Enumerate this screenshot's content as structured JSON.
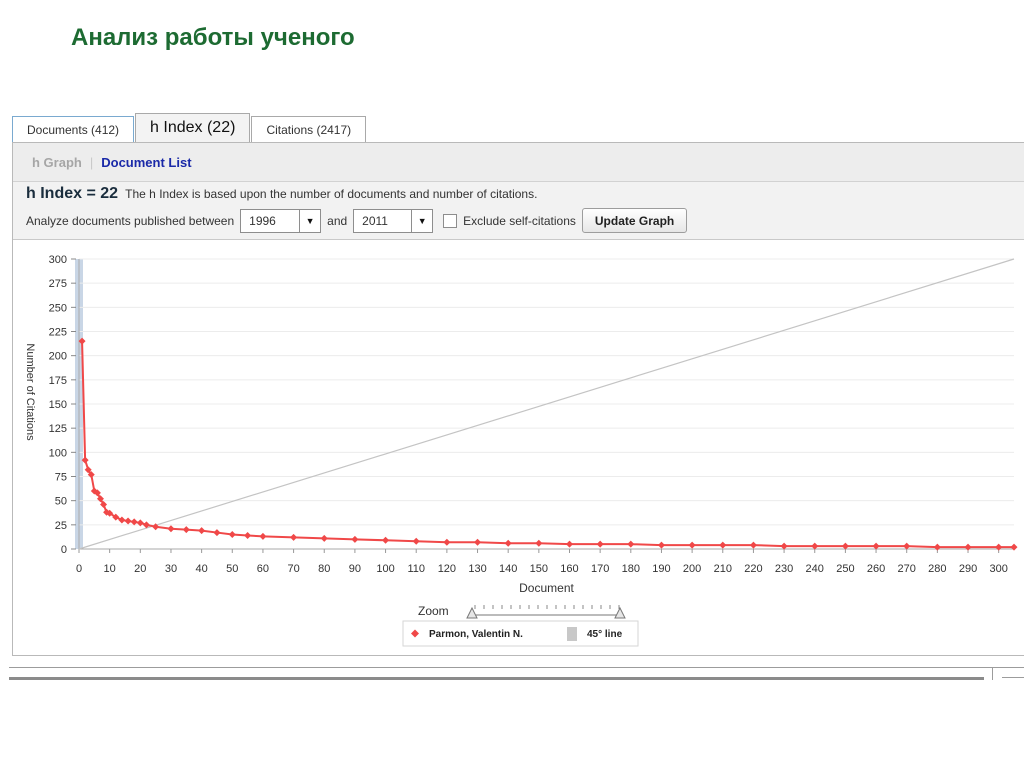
{
  "slide_title": "Анализ работы ученого",
  "tabs": [
    {
      "label": "Documents (412)"
    },
    {
      "label": "h Index (22)"
    },
    {
      "label": "Citations (2417)"
    }
  ],
  "subnav": {
    "h_graph": "h Graph",
    "separator": "|",
    "document_list": "Document List"
  },
  "summary": {
    "h_index_label": "h Index = 22",
    "description": "The h Index is based upon the number of documents and number of citations."
  },
  "filters": {
    "analyze_label": "Analyze documents published between",
    "start_year": "1996",
    "and_label": "and",
    "end_year": "2011",
    "exclude_label": "Exclude self-citations",
    "exclude_checked": false,
    "update_button": "Update Graph"
  },
  "zoom_label": "Zoom",
  "legend": {
    "series": "Parmon, Valentin N.",
    "line": "45° line"
  },
  "colors": {
    "series": "#f04848",
    "diagonal": "#c4c4c4",
    "hbar": "#c9d6e6",
    "title": "#1d6b32"
  },
  "chart_data": {
    "type": "scatter",
    "xlabel": "Document",
    "ylabel": "Number of Citations",
    "xlim": [
      0,
      305
    ],
    "ylim": [
      0,
      300
    ],
    "xticks": [
      0,
      10,
      20,
      30,
      40,
      50,
      60,
      70,
      80,
      90,
      100,
      110,
      120,
      130,
      140,
      150,
      160,
      170,
      180,
      190,
      200,
      210,
      220,
      230,
      240,
      250,
      260,
      270,
      280,
      290,
      300
    ],
    "yticks": [
      0,
      25,
      50,
      75,
      100,
      125,
      150,
      175,
      200,
      225,
      250,
      275,
      300
    ],
    "h_index": 22,
    "diagonal": {
      "name": "45° line",
      "x": [
        0,
        305
      ],
      "y": [
        0,
        300
      ]
    },
    "series": [
      {
        "name": "Parmon, Valentin N.",
        "x": [
          1,
          2,
          3,
          4,
          5,
          6,
          7,
          8,
          9,
          10,
          12,
          14,
          16,
          18,
          20,
          22,
          25,
          30,
          35,
          40,
          45,
          50,
          55,
          60,
          70,
          80,
          90,
          100,
          110,
          120,
          130,
          140,
          150,
          160,
          170,
          180,
          190,
          200,
          210,
          220,
          230,
          240,
          250,
          260,
          270,
          280,
          290,
          300,
          305
        ],
        "y": [
          215,
          92,
          82,
          77,
          60,
          58,
          52,
          46,
          38,
          37,
          33,
          30,
          29,
          28,
          27,
          25,
          23,
          21,
          20,
          19,
          17,
          15,
          14,
          13,
          12,
          11,
          10,
          9,
          8,
          7,
          7,
          6,
          6,
          5,
          5,
          5,
          4,
          4,
          4,
          4,
          3,
          3,
          3,
          3,
          3,
          2,
          2,
          2,
          2
        ]
      }
    ]
  }
}
